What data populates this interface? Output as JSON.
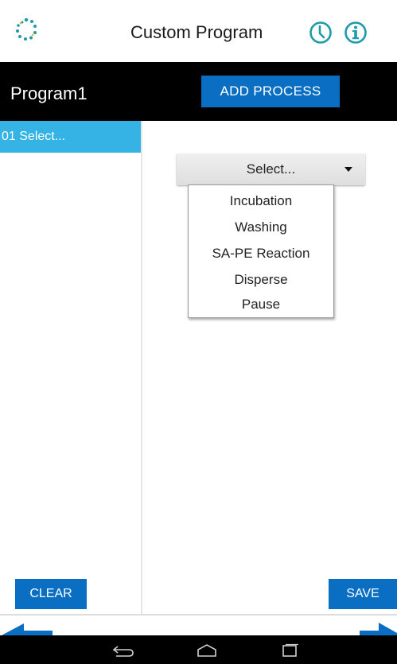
{
  "header": {
    "title": "Custom Program",
    "icons": [
      "logo-icon",
      "clock-icon",
      "info-icon"
    ],
    "accent_color": "#1e9aa8"
  },
  "toolbar": {
    "program_name": "Program1",
    "add_process_label": "ADD PROCESS"
  },
  "steps": [
    {
      "label": "01 Select..."
    }
  ],
  "process_select": {
    "selected": "Select...",
    "options": [
      "Incubation",
      "Washing",
      "SA-PE Reaction",
      "Disperse",
      "Pause"
    ]
  },
  "footer": {
    "clear_label": "CLEAR",
    "save_label": "SAVE"
  },
  "colors": {
    "button_blue": "#0a6fc2",
    "selected_step": "#34b3e4",
    "bar": "#000000"
  }
}
